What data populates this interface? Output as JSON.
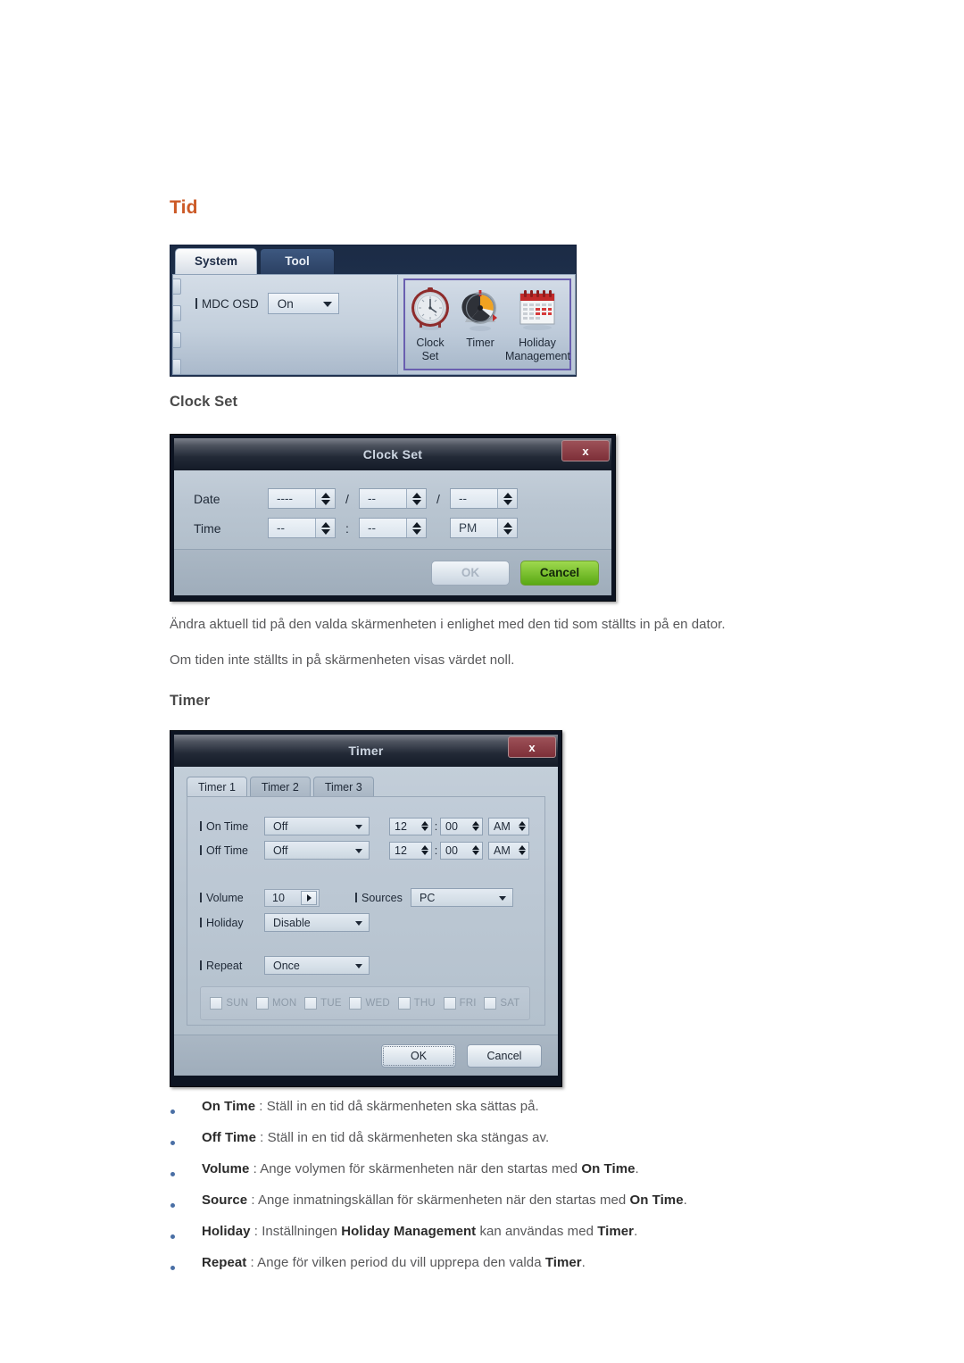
{
  "page": {
    "heading": "Tid",
    "heading_color": "#cc5a27",
    "section_clock_set": "Clock Set",
    "section_timer": "Timer",
    "paragraph_1": "Ändra aktuell tid på den valda skärmenheten i enlighet med den tid som ställts in på en dator.",
    "paragraph_2": "Om tiden inte ställts in på skärmenheten visas värdet noll."
  },
  "mdc_panel": {
    "tabs": [
      {
        "label": "System",
        "active": true
      },
      {
        "label": "Tool",
        "active": false
      }
    ],
    "osd": {
      "label": "MDC OSD",
      "value": "On"
    },
    "icons": [
      {
        "name": "clock-set-icon",
        "caption_line1": "Clock",
        "caption_line2": "Set"
      },
      {
        "name": "timer-icon",
        "caption_line1": "Timer",
        "caption_line2": ""
      },
      {
        "name": "holiday-management-icon",
        "caption_line1": "Holiday",
        "caption_line2": "Management"
      }
    ],
    "group_highlight_color": "#6a5fb0"
  },
  "clock_set_dialog": {
    "title": "Clock Set",
    "close_label": "x",
    "rows": [
      {
        "label": "Date",
        "fields": [
          {
            "value": "----"
          },
          {
            "value": "--"
          },
          {
            "value": "--"
          }
        ],
        "separators": [
          "/",
          "/"
        ]
      },
      {
        "label": "Time",
        "fields": [
          {
            "value": "--"
          },
          {
            "value": "--"
          },
          {
            "value": "PM"
          }
        ],
        "separators": [
          ":",
          ""
        ]
      }
    ],
    "buttons": {
      "ok": "OK",
      "cancel": "Cancel",
      "ok_enabled": false,
      "cancel_color": "#7ec62e"
    }
  },
  "timer_dialog": {
    "title": "Timer",
    "close_label": "x",
    "tabs": [
      {
        "label": "Timer 1",
        "active": true
      },
      {
        "label": "Timer 2",
        "active": false
      },
      {
        "label": "Timer 3",
        "active": false
      }
    ],
    "on_time": {
      "label": "On Time",
      "mode": "Off",
      "hour": "12",
      "minute": "00",
      "meridiem": "AM"
    },
    "off_time": {
      "label": "Off Time",
      "mode": "Off",
      "hour": "12",
      "minute": "00",
      "meridiem": "AM"
    },
    "volume": {
      "label": "Volume",
      "value": "10"
    },
    "sources": {
      "label": "Sources",
      "value": "PC"
    },
    "holiday": {
      "label": "Holiday",
      "value": "Disable"
    },
    "repeat": {
      "label": "Repeat",
      "value": "Once"
    },
    "days": [
      {
        "name": "SUN",
        "checked": false
      },
      {
        "name": "MON",
        "checked": false
      },
      {
        "name": "TUE",
        "checked": false
      },
      {
        "name": "WED",
        "checked": false
      },
      {
        "name": "THU",
        "checked": false
      },
      {
        "name": "FRI",
        "checked": false
      },
      {
        "name": "SAT",
        "checked": false
      }
    ],
    "buttons": {
      "ok": "OK",
      "cancel": "Cancel"
    }
  },
  "bullets": [
    {
      "term": "On Time",
      "sep": " : ",
      "text_before": "Ställ in en tid då skärmenheten ska sättas på.",
      "bold_mid": "",
      "text_after": ""
    },
    {
      "term": "Off Time",
      "sep": " : ",
      "text_before": "Ställ in en tid då skärmenheten ska stängas av.",
      "bold_mid": "",
      "text_after": ""
    },
    {
      "term": "Volume",
      "sep": " : ",
      "text_before": "Ange volymen för skärmenheten när den startas med ",
      "bold_mid": "On Time",
      "text_after": "."
    },
    {
      "term": "Source",
      "sep": " : ",
      "text_before": "Ange inmatningskällan för skärmenheten när den startas med ",
      "bold_mid": "On Time",
      "text_after": "."
    },
    {
      "term": "Holiday",
      "sep": " : ",
      "text_before": "Inställningen ",
      "bold_mid": "Holiday Management",
      "text_after": " kan användas med ",
      "bold_end": "Timer",
      "text_end": "."
    },
    {
      "term": "Repeat",
      "sep": " : ",
      "text_before": "Ange för vilken period du vill upprepa den valda ",
      "bold_mid": "Timer",
      "text_after": "."
    }
  ]
}
